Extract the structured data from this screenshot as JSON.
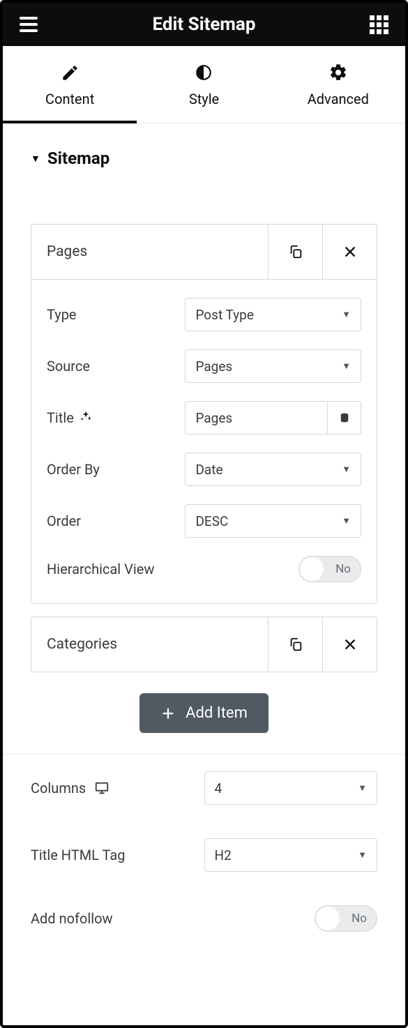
{
  "header": {
    "title": "Edit Sitemap"
  },
  "tabs": {
    "content": "Content",
    "style": "Style",
    "advanced": "Advanced"
  },
  "section": {
    "title": "Sitemap"
  },
  "items": [
    {
      "title": "Pages",
      "fields": {
        "type_label": "Type",
        "type_value": "Post Type",
        "source_label": "Source",
        "source_value": "Pages",
        "title_label": "Title",
        "title_value": "Pages",
        "orderby_label": "Order By",
        "orderby_value": "Date",
        "order_label": "Order",
        "order_value": "DESC",
        "hierarchical_label": "Hierarchical View",
        "hierarchical_value": "No"
      }
    },
    {
      "title": "Categories"
    }
  ],
  "add_item": "Add Item",
  "outer": {
    "columns_label": "Columns",
    "columns_value": "4",
    "htmltag_label": "Title HTML Tag",
    "htmltag_value": "H2",
    "nofollow_label": "Add nofollow",
    "nofollow_value": "No"
  }
}
